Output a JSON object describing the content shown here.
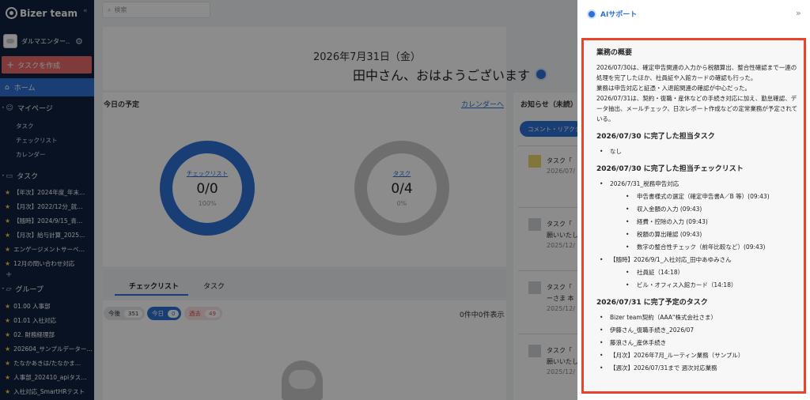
{
  "sidebar": {
    "logo": "Bizer team",
    "collapse": "«",
    "team_name": "ダルマエンター…",
    "create_label": "タスクを作成",
    "home_label": "ホーム",
    "mypage": {
      "label": "マイページ",
      "items": [
        "タスク",
        "チェックリスト",
        "カレンダー"
      ]
    },
    "tasks": {
      "label": "タスク",
      "items": [
        "【年次】2024年度_年末…",
        "【月次】2022/12分_就…",
        "【随時】2024/9/15_青…",
        "【月次】給与計算_2025…",
        "エンゲージメントサーベ…",
        "12月の問い合わせ対応"
      ]
    },
    "groups": {
      "label": "グループ",
      "items": [
        "01.00 人事部",
        "01.01 入社対応",
        "02. 財務経理部",
        "202604_サンプルデーター…",
        "たなかあきは/たなかま…",
        "人事部_202410_apiタス…",
        "入社対応_SmartHRテスト"
      ]
    }
  },
  "main": {
    "search_placeholder": "検索",
    "date": "2026年7月31日（金）",
    "greeting": "田中さん、おはようございます",
    "today_title": "今日の予定",
    "calendar_link": "カレンダーへ",
    "notice_title": "お知らせ（未読）",
    "donut_checklist": {
      "label": "チェックリスト",
      "value": "0/0",
      "pct": "100%"
    },
    "donut_task": {
      "label": "タスク",
      "value": "0/4",
      "pct": "0%"
    },
    "tabs": [
      "チェックリスト",
      "タスク"
    ],
    "filters": [
      {
        "label": "今後",
        "count": "351"
      },
      {
        "label": "今日",
        "count": "0"
      },
      {
        "label": "過去",
        "count": "49"
      }
    ],
    "count_text": "0件中0件表示",
    "notice_filter": "コメント・リアクション",
    "notices": [
      {
        "line1": "タスク「",
        "line2": "2026/07/"
      },
      {
        "line1": "タスク「",
        "line2": "願いいたし",
        "line3": "2025/12/"
      },
      {
        "line1": "タスク「",
        "line2": "ーさま 本",
        "line3": "2025/12/"
      },
      {
        "line1": "タスク「",
        "line2": "願いいたし",
        "line3": "2025/12/"
      }
    ]
  },
  "ai": {
    "title": "AIサポート",
    "close": "»",
    "summary_heading": "業務の概要",
    "summary_p1": "2026/07/30は、確定申告関連の入力から税額算出、整合性確認まで一連の処理を完了したほか、社員証や入館カードの確認も行った。",
    "summary_p2": "業務は申告対応と証憑・入退館関連の確認が中心だった。",
    "summary_p3": "2026/07/31は、契約・復職・産休などの手続き対応に加え、勤怠確認、データ抽出、メールチェック、日次レポート作成などの定常業務が予定されている。",
    "done_tasks_heading": "2026/07/30 に完了した担当タスク",
    "done_tasks": [
      "なし"
    ],
    "done_checklists_heading": "2026/07/30 に完了した担当チェックリスト",
    "checklist1": {
      "title": "2026/7/31_税務申告対応",
      "items": [
        "申告書様式の選定（確定申告書A／B 等）(09:43)",
        "収入金額の入力 (09:43)",
        "経費・控除の入力 (09:43)",
        "税額の算出確認 (09:43)",
        "数字の整合性チェック（前年比較など）(09:43)"
      ]
    },
    "checklist2": {
      "title": "【随時】2026/9/1_入社対応_田中あゆみさん",
      "items": [
        "社員証（14:18）",
        "ビル・オフィス入館カード（14:18）"
      ]
    },
    "planned_heading": "2026/07/31 に完了予定のタスク",
    "planned": [
      "Bizer team契約（AAA\"株式会社さま）",
      "伊藤さん_復職手続き_2026/07",
      "藤浪さん_産休手続き",
      "【月次】2026年7月_ルーティン業務（サンプル）",
      "【週次】2026/07/31まで 週次対応業務"
    ]
  }
}
